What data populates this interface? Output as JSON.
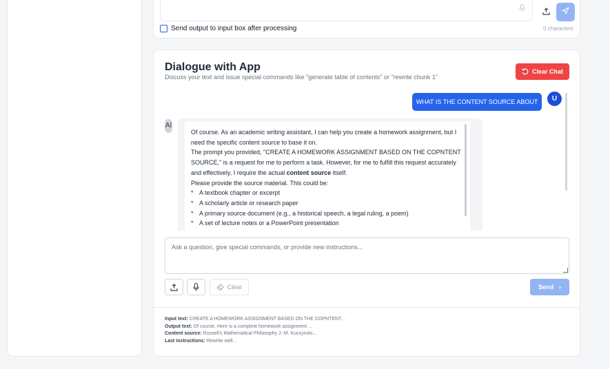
{
  "top_panel": {
    "checkbox_label": "Send output to input box after processing",
    "char_count": "0 characters"
  },
  "dialogue": {
    "title": "Dialogue with App",
    "subtitle": "Discuss your text and issue special commands like \"generate table of contents\" or \"rewrite chunk 1\"",
    "clear_chat_label": "Clear Chat",
    "user_message": "WHAT IS THE CONTENT SOURCE ABOUT",
    "user_avatar": "U",
    "ai_avatar": "AI",
    "ai_message": {
      "p1": "Of course. As an academic writing assistant, I can help you create a homework assignment, but I need the specific content source to base it on.",
      "p2_pre": "The prompt you provided, \"CREATE A HOMEWORK ASSIGNMENT BASED ON THE COPNTENT SOURCE,\" is a request for me to perform a task. However, for me to fulfill this request accurately and effectively, I require the actual ",
      "p2_bold": "content source",
      "p2_post": " itself.",
      "p3": "Please provide the source material. This could be:",
      "bullets": [
        "A textbook chapter or excerpt",
        "A scholarly article or research paper",
        "A primary source document (e.g., a historical speech, a legal ruling, a poem)",
        "A set of lecture notes or a PowerPoint presentation"
      ]
    },
    "input_placeholder": "Ask a question, give special commands, or provide new instructions...",
    "clear_label": "Clear",
    "send_label": "Send"
  },
  "summary": {
    "input_text_label": "Input text:",
    "input_text": "CREATE A HOMEWORK ASSIGNMENT BASED ON THE COPNTENT...",
    "output_text_label": "Output text:",
    "output_text": "Of course. Here is a complete homework assignment ...",
    "content_source_label": "Content source:",
    "content_source": "Russell's Mathematical Philosophy J.-M. Kuczynski...",
    "last_instructions_label": "Last instructions:",
    "last_instructions": "Rewrite well..."
  },
  "colors": {
    "primary": "#2563eb",
    "danger": "#ef4444",
    "send_disabled": "#93b4f4"
  }
}
